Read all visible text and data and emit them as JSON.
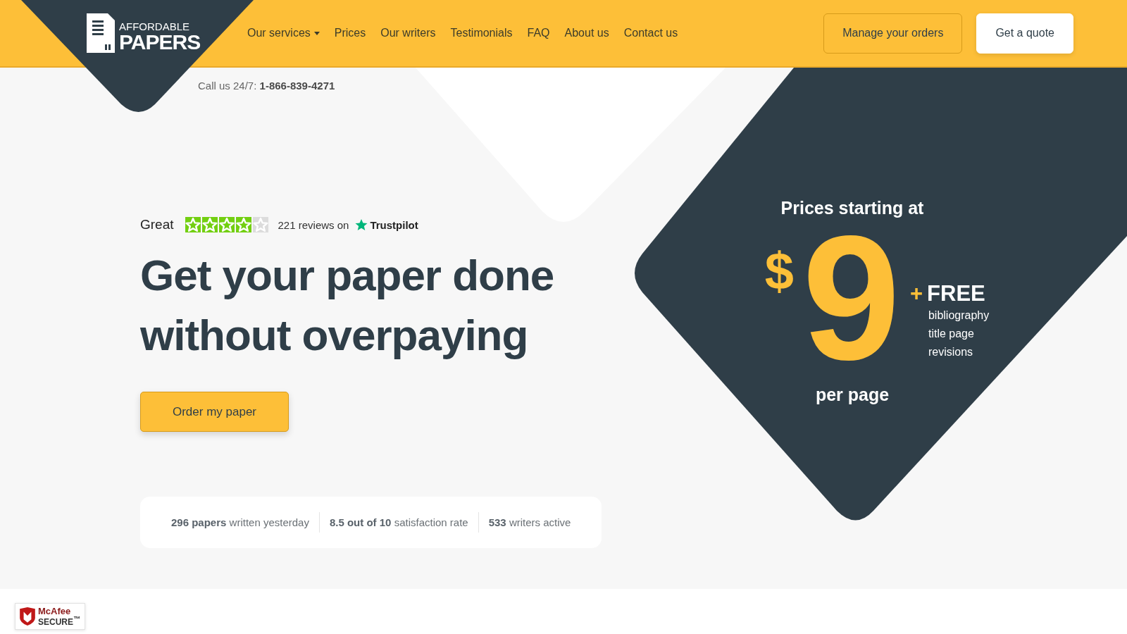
{
  "header": {
    "logo": {
      "line_1": "AFFORDABLE",
      "line_2": "PAPERS"
    },
    "nav": [
      {
        "label": "Our services",
        "has_dropdown": true
      },
      {
        "label": "Prices",
        "has_dropdown": false
      },
      {
        "label": "Our writers",
        "has_dropdown": false
      },
      {
        "label": "Testimonials",
        "has_dropdown": false
      },
      {
        "label": "FAQ",
        "has_dropdown": false
      },
      {
        "label": "About us",
        "has_dropdown": false
      },
      {
        "label": "Contact us",
        "has_dropdown": false
      }
    ],
    "buttons": [
      {
        "label": "Manage your orders",
        "kind": "outline"
      },
      {
        "label": "Get a quote",
        "kind": "solid"
      }
    ]
  },
  "phone": {
    "label": "Call us 24/7:",
    "number": "1-866-839-4271"
  },
  "rating": {
    "label": "Great",
    "stars": 4,
    "reviews": "221 reviews on",
    "brand": "Trustpilot"
  },
  "headline": [
    "Get your paper done",
    "without overpaying"
  ],
  "cta": "Order my paper",
  "stats": [
    "**296 papers** written yesterday",
    "**8.5 out of 10** satisfaction rate",
    "**533** writers active"
  ],
  "price": {
    "title": "Prices starting at",
    "currency": "$",
    "amount": "9",
    "plus": "+",
    "free": "FREE",
    "extras": [
      "bibliography",
      "title page",
      "revisions"
    ],
    "unit": "per page"
  },
  "badge": {
    "line_1": "McAfee",
    "line_2": "SECURE$^{™}$"
  }
}
